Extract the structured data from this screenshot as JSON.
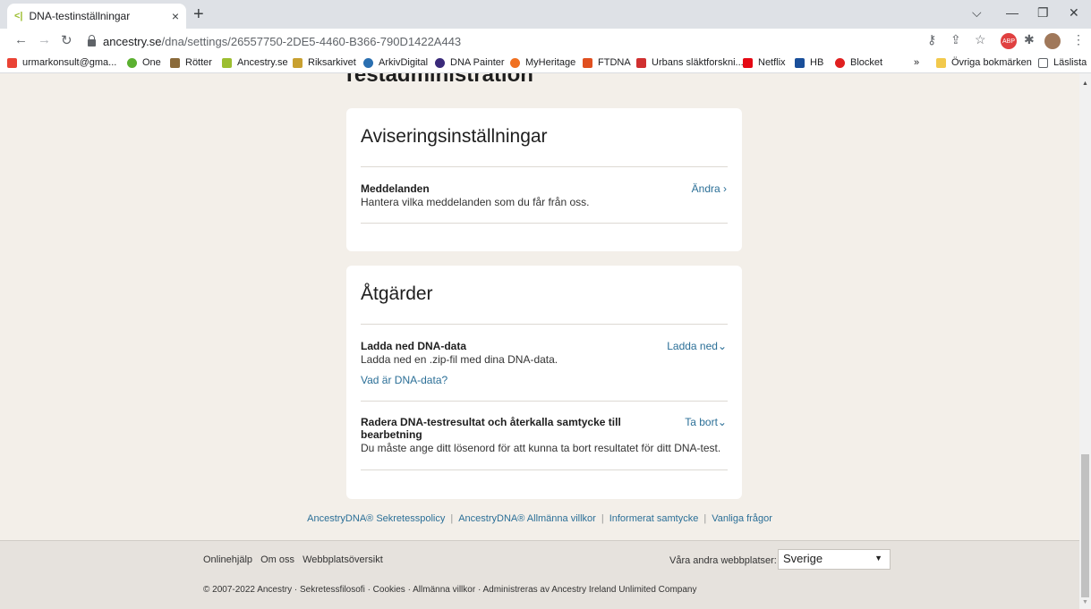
{
  "browser": {
    "tab_title": "DNA-testinställningar",
    "tab_close": "×",
    "new_tab": "+",
    "url_host": "ancestry.se",
    "url_path": "/dna/settings/26557750-2DE5-4460-B366-790D1422A443",
    "bookmarks": [
      "urmarkonsult@gma...",
      "One",
      "Rötter",
      "Ancestry.se",
      "Riksarkivet",
      "ArkivDigital",
      "DNA Painter",
      "MyHeritage",
      "FTDNA",
      "Urbans släktforskni...",
      "Netflix",
      "HB",
      "Blocket"
    ],
    "bookmarks_more": "»",
    "other_bookmarks": "Övriga bokmärken",
    "reading_list": "Läslista"
  },
  "page": {
    "section_title": "Testadministration",
    "notifications": {
      "title": "Aviseringsinställningar",
      "messages_title": "Meddelanden",
      "messages_desc": "Hantera vilka meddelanden som du får från oss.",
      "change_label": "Ändra ›"
    },
    "actions": {
      "title": "Åtgärder",
      "download_title": "Ladda ned DNA-data",
      "download_desc": "Ladda ned en .zip-fil med dina DNA-data.",
      "download_action": "Ladda ned⌄",
      "what_is_link": "Vad är DNA-data?",
      "delete_title": "Radera DNA-testresultat och återkalla samtycke till bearbetning",
      "delete_desc": "Du måste ange ditt lösenord för att kunna ta bort resultatet för ditt DNA-test.",
      "delete_action": "Ta bort⌄"
    },
    "legal_links": [
      "AncestryDNA® Sekretesspolicy",
      "AncestryDNA® Allmänna villkor",
      "Informerat samtycke",
      "Vanliga frågor"
    ],
    "legal_separator": "|",
    "footer": {
      "links": [
        "Onlinehjälp",
        "Om oss",
        "Webbplatsöversikt"
      ],
      "other_sites_label": "Våra andra webbplatser:",
      "country": "Sverige",
      "copyright": "© 2007-2022 Ancestry · Sekretessfilosofi · Cookies · Allmänna villkor · Administreras av Ancestry Ireland Unlimited Company"
    }
  },
  "colors": {
    "page_bg": "#f3efe9",
    "link": "#2b6f97",
    "footer_bg": "#e6e2dd"
  }
}
